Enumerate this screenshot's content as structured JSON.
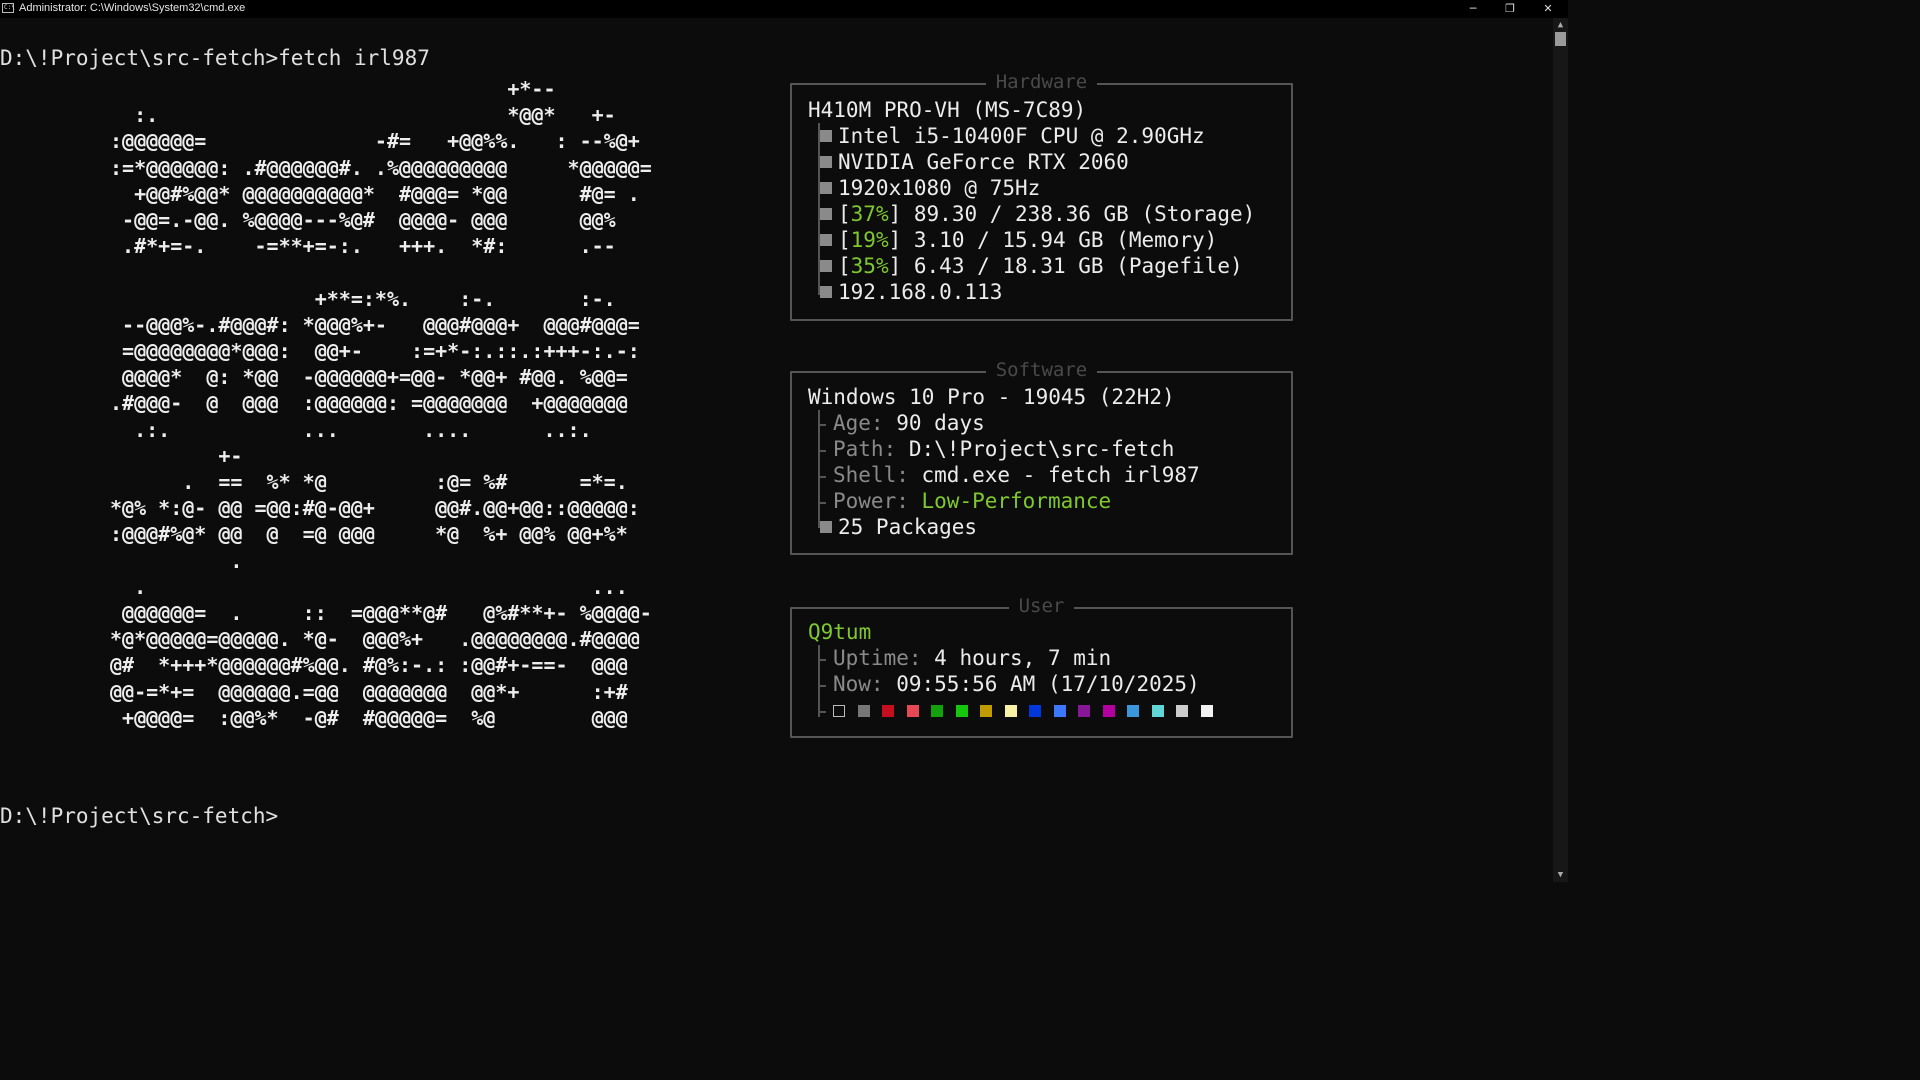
{
  "window": {
    "title": "Administrator: C:\\Windows\\System32\\cmd.exe",
    "minimize": "─",
    "restore": "❐",
    "close": "✕"
  },
  "terminal": {
    "command_line": "D:\\!Project\\src-fetch>fetch irl987",
    "prompt_line": "D:\\!Project\\src-fetch>",
    "ascii_art": "                                 +*--\n  :.                             *@@*   +-\n:@@@@@@=              -#=   +@@%%.   : --%@+\n:=*@@@@@@: .#@@@@@@#. .%@@@@@@@@@     *@@@@@=\n  +@@#%@@* @@@@@@@@@@*  #@@@= *@@      #@= .\n -@@=.-@@. %@@@@---%@#  @@@@- @@@      @@%\n .#*+=-.    -=**+=-:.   +++.  *#:      .--\n\n                 +**=:*%.    :-.       :-.\n --@@@%-.#@@@#: *@@@%+-   @@@#@@@+  @@@#@@@=\n =@@@@@@@@*@@@:  @@+-    :=+*-:.::.:+++-:.-:\n @@@@*  @: *@@  -@@@@@@+=@@- *@@+ #@@. %@@=\n.#@@@-  @  @@@  :@@@@@@: =@@@@@@@  +@@@@@@@\n  .:.           ...       ....      ..:.\n         +-\n      .  ==  %* *@         :@= %#      =*=.\n*@% *:@- @@ =@@:#@-@@+     @@#.@@+@@::@@@@@:\n:@@@#%@* @@  @  =@ @@@     *@  %+ @@% @@+%*\n          .\n  .                                     ...\n @@@@@@=  .     ::  =@@@**@#   @%#**+- %@@@@-\n*@*@@@@@=@@@@@. *@-  @@@%+   .@@@@@@@@.#@@@@\n@#  *+++*@@@@@@#%@@. #@%:-.: :@@#+-==-  @@@\n@@-=*+=  @@@@@@.=@@  @@@@@@@  @@*+      :+#\n +@@@@=  :@@%*  -@#  #@@@@@=  %@        @@@"
  },
  "hardware": {
    "title": "Hardware",
    "board": "H410M PRO-VH (MS-7C89)",
    "items": [
      {
        "text": "Intel i5-10400F CPU @ 2.90GHz"
      },
      {
        "text": "NVIDIA GeForce RTX 2060"
      },
      {
        "text": "1920x1080 @ 75Hz"
      },
      {
        "pct": "37%",
        "text": " 89.30 / 238.36 GB (Storage)"
      },
      {
        "pct": "19%",
        "text": " 3.10 / 15.94 GB (Memory)"
      },
      {
        "pct": "35%",
        "text": " 6.43 / 18.31 GB (Pagefile)"
      },
      {
        "text": "192.168.0.113"
      }
    ]
  },
  "software": {
    "title": "Software",
    "os": "Windows 10 Pro - 19045 (22H2)",
    "age_label": "Age:",
    "age_value": "90 days",
    "path_label": "Path:",
    "path_value": "D:\\!Project\\src-fetch",
    "shell_label": "Shell:",
    "shell_value": "cmd.exe - fetch irl987",
    "power_label": "Power:",
    "power_value": "Low-Performance",
    "packages": "25 Packages"
  },
  "user": {
    "title": "User",
    "name": "Q9tum",
    "uptime_label": "Uptime:",
    "uptime_value": "4 hours, 7 min",
    "now_label": "Now:",
    "now_value": "09:55:56 AM (17/10/2025)",
    "palette": [
      "#0c0c0c",
      "#767676",
      "#c50f1f",
      "#e74856",
      "#13a10e",
      "#16c60c",
      "#c19c00",
      "#f9f1a5",
      "#0037da",
      "#3b78ff",
      "#881798",
      "#b4009e",
      "#3a96dd",
      "#61d6d6",
      "#cccccc",
      "#f2f2f2"
    ]
  },
  "colors": {
    "accent_green": "#7fc92e",
    "background": "#0c0c0c"
  }
}
